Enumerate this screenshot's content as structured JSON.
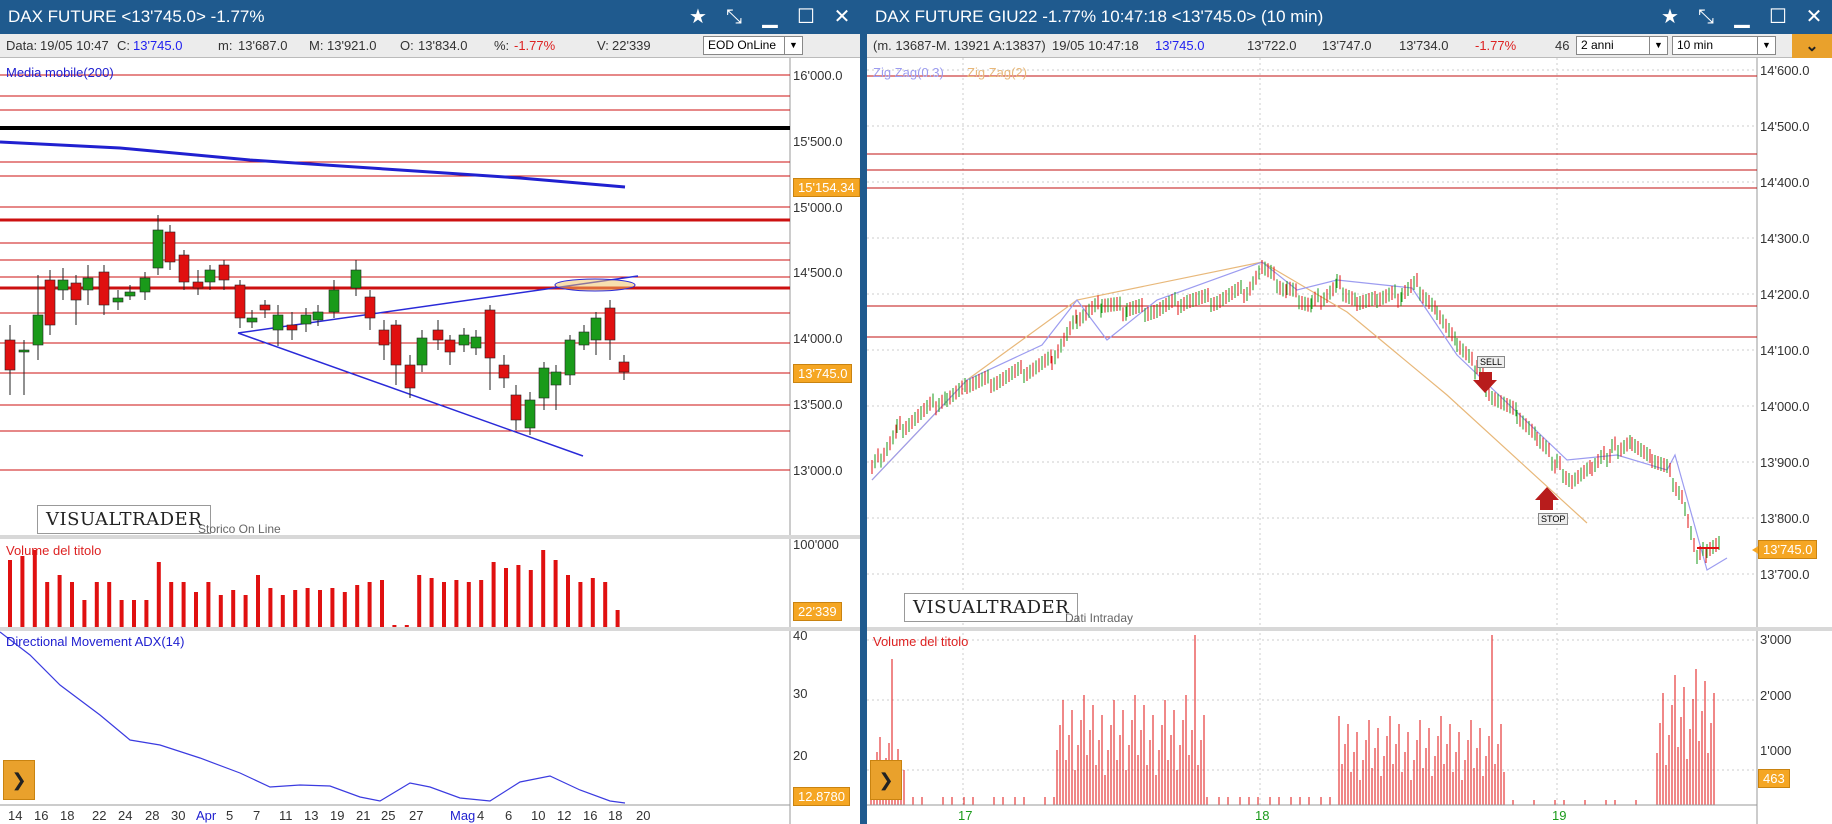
{
  "left": {
    "title": "DAX FUTURE <13'745.0> -1.77%",
    "info": {
      "data_label": "Data:",
      "data": "19/05 10:47",
      "c_label": "C:",
      "c": "13'745.0",
      "m_label": "m:",
      "m": "13'687.0",
      "M_label": "M:",
      "M": "13'921.0",
      "o_label": "O:",
      "o": "13'834.0",
      "pct_label": "%:",
      "pct": "-1.77%",
      "v_label": "V:",
      "v": "22'339"
    },
    "selector": "EOD OnLine",
    "indicator_label": "Media mobile(200)",
    "price_labels": [
      "16'000.0",
      "15'500.0",
      "15'000.0",
      "14'500.0",
      "14'000.0",
      "13'500.0",
      "13'000.0"
    ],
    "ma_badge": "15'154.34",
    "price_badge": "13'745.0",
    "logo": "VISUALTRADER",
    "logo_sub": "Storico On Line",
    "volume_title": "Volume del titolo",
    "volume_axis": "100'000",
    "volume_badge": "22'339",
    "adx_title": "Directional Movement ADX(14)",
    "adx_axis": [
      "40",
      "30",
      "20"
    ],
    "adx_badge": "12.8780",
    "xlabels": [
      "14",
      "16",
      "18",
      "22",
      "24",
      "28",
      "30",
      "Apr",
      "5",
      "7",
      "11",
      "13",
      "19",
      "21",
      "25",
      "27",
      "Mag",
      "4",
      "6",
      "10",
      "12",
      "16",
      "18",
      "20"
    ],
    "colors": {
      "up": "#1a9a1a",
      "down": "#e01010",
      "ma": "#2020d0",
      "hline": "#cc1010"
    }
  },
  "right": {
    "title": "DAX FUTURE GIU22 -1.77% 10:47:18 <13'745.0> (10 min)",
    "info": {
      "range": "(m. 13687-M. 13921 A:13837)",
      "datetime": "19/05 10:47:18",
      "c1": "13'745.0",
      "v2": "13'722.0",
      "v3": "13'747.0",
      "v4": "13'734.0",
      "pct": "-1.77%",
      "tr": "46"
    },
    "sel_period": "2 anni",
    "sel_interval": "10 min",
    "zz1": "Zig Zag(0.3)",
    "zz2": "Zig Zag(2)",
    "price_labels": [
      "14'600.0",
      "14'500.0",
      "14'400.0",
      "14'300.0",
      "14'200.0",
      "14'100.0",
      "14'000.0",
      "13'900.0",
      "13'800.0",
      "13'700.0"
    ],
    "price_badge": "13'745.0",
    "sell_label": "SELL",
    "stop_label": "STOP",
    "logo": "VISUALTRADER",
    "logo_sub": "Dati Intraday",
    "volume_title": "Volume del titolo",
    "volume_axis": [
      "3'000",
      "2'000",
      "1'000"
    ],
    "volume_badge": "463",
    "xlabels": [
      "17",
      "18",
      "19"
    ]
  }
}
